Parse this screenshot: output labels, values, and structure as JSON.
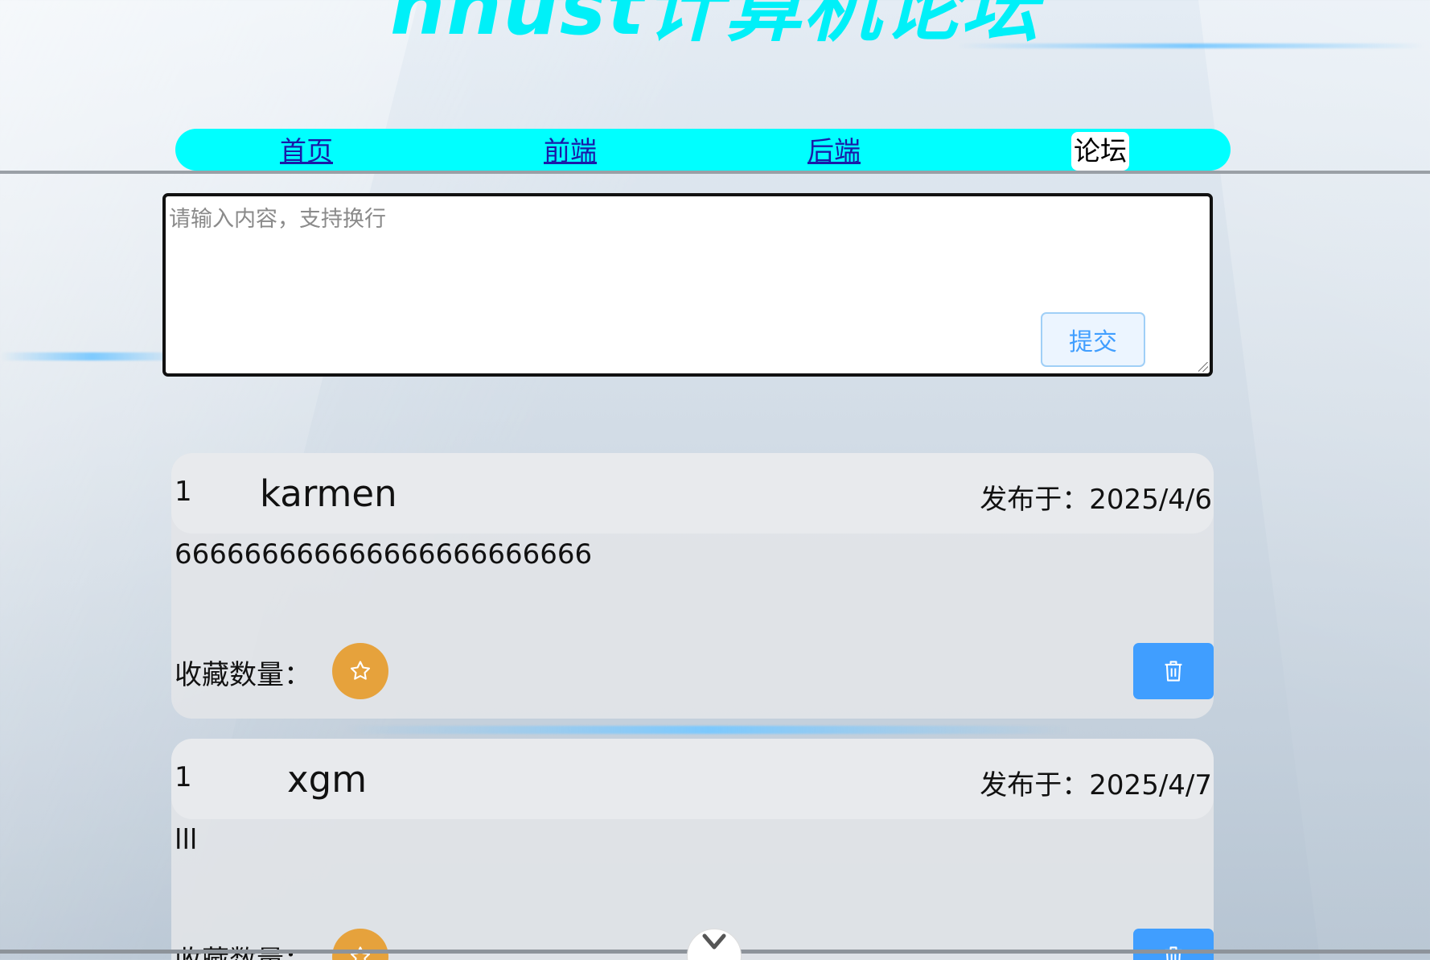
{
  "site": {
    "title": "hnust计算机论坛"
  },
  "nav": {
    "items": [
      {
        "label": "首页",
        "active": false
      },
      {
        "label": "前端",
        "active": false
      },
      {
        "label": "后端",
        "active": false
      },
      {
        "label": "论坛",
        "active": true
      }
    ]
  },
  "composer": {
    "placeholder": "请输入内容，支持换行",
    "value": "",
    "submit_label": "提交"
  },
  "posts": [
    {
      "index": "1",
      "author": "karmen",
      "date": "发布于：2025/4/6",
      "content": "666666666666666666666666",
      "fav_label": "收藏数量：",
      "fav_icon": "star-icon",
      "delete_icon": "trash-icon"
    },
    {
      "index": "1",
      "author": "xgm",
      "date": "发布于：2025/4/7",
      "content": "lll",
      "fav_label": "收藏数量：",
      "fav_icon": "star-icon",
      "delete_icon": "trash-icon"
    }
  ],
  "colors": {
    "title": "#00f0f8",
    "nav_bar": "#00ffff",
    "favorite": "#e6a23c",
    "delete": "#409eff",
    "submit_text": "#409eff"
  }
}
